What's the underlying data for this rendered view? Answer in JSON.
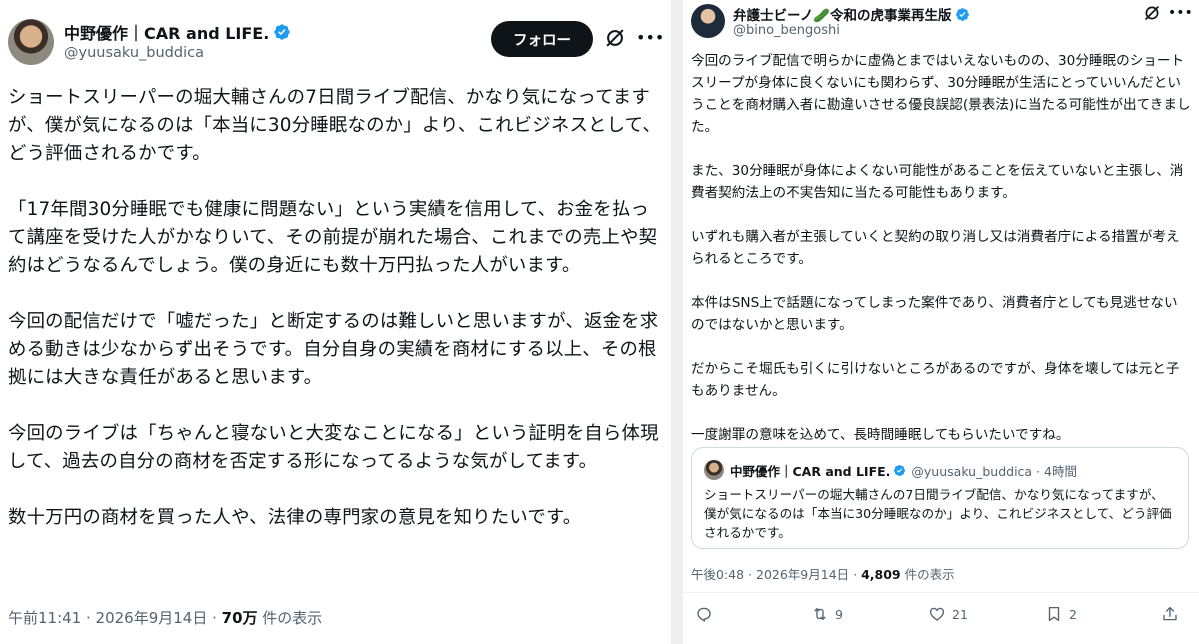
{
  "left_post": {
    "author_name": "中野優作｜CAR and LIFE.",
    "handle": "@yuusaku_buddica",
    "follow_label": "フォロー",
    "paragraphs": [
      "ショートスリーパーの堀大輔さんの7日間ライブ配信、かなり気になってますが、僕が気になるのは「本当に30分睡眠なのか」より、これビジネスとして、どう評価されるかです。",
      "「17年間30分睡眠でも健康に問題ない」という実績を信用して、お金を払って講座を受けた人がかなりいて、その前提が崩れた場合、これまでの売上や契約はどうなるんでしょう。僕の身近にも数十万円払った人がいます。",
      "今回の配信だけで「嘘だった」と断定するのは難しいと思いますが、返金を求める動きは少なからず出そうです。自分自身の実績を商材にする以上、その根拠には大きな責任があると思います。",
      "今回のライブは「ちゃんと寝ないと大変なことになる」という証明を自ら体現して、過去の自分の商材を否定する形になってるような気がしてます。",
      "数十万円の商材を買った人や、法律の専門家の意見を知りたいです。"
    ],
    "timestamp": "午前11:41 · 2026年9月14日 · ",
    "views_count": "70万",
    "views_label": " 件の表示"
  },
  "right_post": {
    "author_name": "弁護士ビーノ🥒令和の虎事業再生版",
    "handle": "@bino_bengoshi",
    "paragraphs": [
      "今回のライブ配信で明らかに虚偽とまではいえないものの、30分睡眠のショートスリープが身体に良くないにも関わらず、30分睡眠が生活にとっていいんだということを商材購入者に勘違いさせる優良誤認(景表法)に当たる可能性が出てきました。",
      "また、30分睡眠が身体によくない可能性があることを伝えていないと主張し、消費者契約法上の不実告知に当たる可能性もあります。",
      "いずれも購入者が主張していくと契約の取り消し又は消費者庁による措置が考えられるところです。",
      "本件はSNS上で話題になってしまった案件であり、消費者庁としても見逃せないのではないかと思います。",
      "だからこそ堀氏も引くに引けないところがあるのですが、身体を壊しては元と子もありません。",
      "一度謝罪の意味を込めて、長時間睡眠してもらいたいですね。"
    ],
    "quote": {
      "author_name": "中野優作｜CAR and LIFE.",
      "handle_time": "@yuusaku_buddica · 4時間",
      "text": "ショートスリーパーの堀大輔さんの7日間ライブ配信、かなり気になってますが、僕が気になるのは「本当に30分睡眠なのか」より、これビジネスとして、どう評価されるかです。"
    },
    "timestamp": "午後0:48 · 2026年9月14日 · ",
    "views_count": "4,809",
    "views_label": " 件の表示",
    "actions": {
      "reply_count": "",
      "retweet_count": "9",
      "like_count": "21",
      "bookmark_count": "2"
    }
  },
  "colors": {
    "text": "#0f1419",
    "secondary": "#536471",
    "verified": "#1d9bf0",
    "follow_bg": "#0f1419"
  },
  "icons": [
    "verified-badge-icon",
    "grok-icon",
    "more-icon",
    "reply-icon",
    "retweet-icon",
    "like-icon",
    "bookmark-icon",
    "share-icon"
  ]
}
